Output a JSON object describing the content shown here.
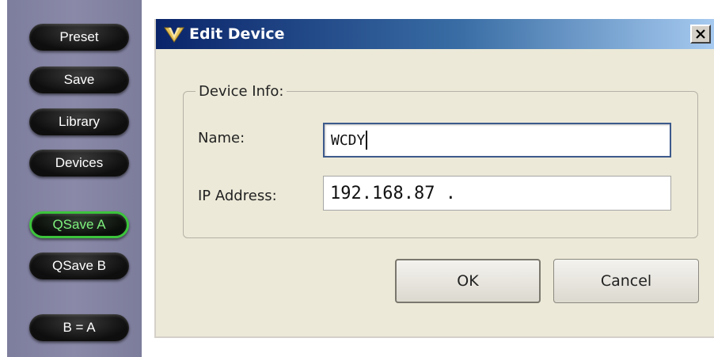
{
  "side_panel": {
    "buttons": [
      {
        "label": "Preset"
      },
      {
        "label": "Save"
      },
      {
        "label": "Library"
      },
      {
        "label": "Devices"
      },
      {
        "label": "QSave A",
        "active": true
      },
      {
        "label": "QSave B"
      },
      {
        "label": "B = A"
      }
    ]
  },
  "dialog": {
    "title": "Edit Device",
    "title_icon": "double-v-logo-icon",
    "close_icon": "close-x-icon",
    "group_label": "Device Info:",
    "name_label": "Name:",
    "name_value": "WCDY",
    "ip_label": "IP Address:",
    "ip_value": "192.168.87 .",
    "ok_label": "OK",
    "cancel_label": "Cancel"
  },
  "colors": {
    "panel_bg": "#8a89a8",
    "titlebar_start": "#0a246a",
    "titlebar_end": "#a6caf0",
    "active_button_border": "#3cc43c",
    "dialog_bg": "#ece9d8"
  }
}
